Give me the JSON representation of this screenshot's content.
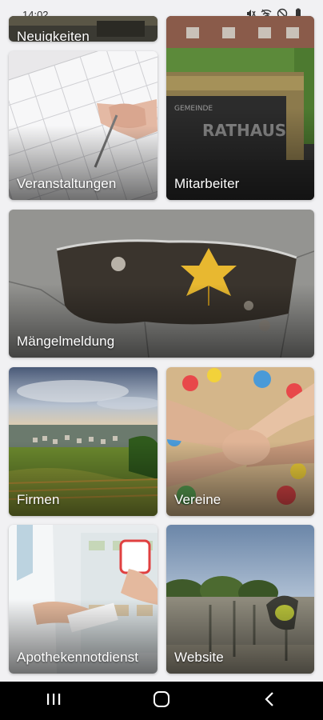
{
  "status_bar": {
    "time": "14:02",
    "icons": [
      "mute-icon",
      "wifi-icon",
      "do-not-disturb-icon",
      "battery-icon"
    ]
  },
  "tiles": {
    "neuigkeiten": "Neuigkeiten",
    "veranstaltungen": "Veranstaltungen",
    "mitarbeiter": "Mitarbeiter",
    "maengelmeldung": "Mängelmeldung",
    "firmen": "Firmen",
    "vereine": "Vereine",
    "apothekennotdienst": "Apothekennotdienst",
    "website": "Website"
  },
  "nav_bar": {
    "icons": [
      "recents-icon",
      "home-icon",
      "back-icon"
    ]
  }
}
